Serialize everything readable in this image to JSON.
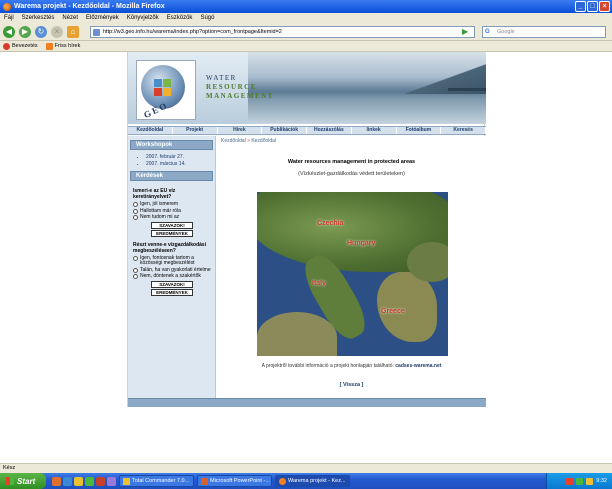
{
  "window": {
    "title": "Warema projekt - Kezdőoldal - Mozilla Firefox",
    "controls": [
      "_",
      "□",
      "×"
    ]
  },
  "menu": [
    "Fájl",
    "Szerkesztés",
    "Nézet",
    "Előzmények",
    "Könyvjelzők",
    "Eszközök",
    "Súgó"
  ],
  "navbar": {
    "url": "http://w3.geo.info.hu/warema/index.php?option=com_frontpage&Itemid=2",
    "search_placeholder": "Google",
    "search_icon_label": "G"
  },
  "bookmarks": [
    {
      "label": "Bevezetés"
    },
    {
      "label": "Friss hírek"
    }
  ],
  "banner": {
    "logo_text": "GEO",
    "title_line1": "WATER",
    "title_line2": "RESOURCE",
    "title_line3": "MANAGEMENT"
  },
  "topnav": [
    "Kezdőoldal",
    "Projekt",
    "Hírek",
    "Publikációk",
    "Hozzászólás",
    "linkek",
    "Fotóalbum",
    "Keresés"
  ],
  "sidebar": {
    "workshops_heading": "Workshopok",
    "workshops": [
      "2007. február 27.",
      "2007. március 14."
    ],
    "questions_heading": "Kérdések",
    "poll1": {
      "question": "Ismeri-e az EU víz keretirányelvet?",
      "options": [
        "Igen, jól ismerem",
        "Hallottam már róla",
        "Nem tudom mi az"
      ],
      "vote_label": "SZAVAZOK!",
      "results_label": "EREDMÉNYEK"
    },
    "poll2": {
      "question": "Részt venne-e vízgazdálkodási megbeszéléseen?",
      "options": [
        "Igen, fontosnak tartom a közösségi megbeszélést",
        "Talán, ha van gyakorlati értelme",
        "Nem, döntenek a szakértők"
      ],
      "vote_label": "SZAVAZOK!",
      "results_label": "EREDMÉNYEK"
    }
  },
  "content": {
    "breadcrumb_home": "Kezdőoldal",
    "breadcrumb_sep": "»",
    "breadcrumb_current": "Kezdőoldal",
    "title": "Water resources management in protected areas",
    "subtitle": "(Vízkészlet-gazdálkodás védett területeken)",
    "map_labels": {
      "czech": "Czechia",
      "hungary": "Hungary",
      "italy": "Italy",
      "greece": "Greece"
    },
    "info_text": "A projektről további információ a projekt honlapján található:",
    "info_link": "cadses-warema.net",
    "back_link": "[ Vissza ]"
  },
  "statusbar": {
    "text": "Kész"
  },
  "taskbar": {
    "start_label": "Start",
    "tasks": [
      "Total Commander 7.0...",
      "Microsoft PowerPoint -...",
      "Warema projekt - Kez..."
    ],
    "clock": "9:32"
  }
}
